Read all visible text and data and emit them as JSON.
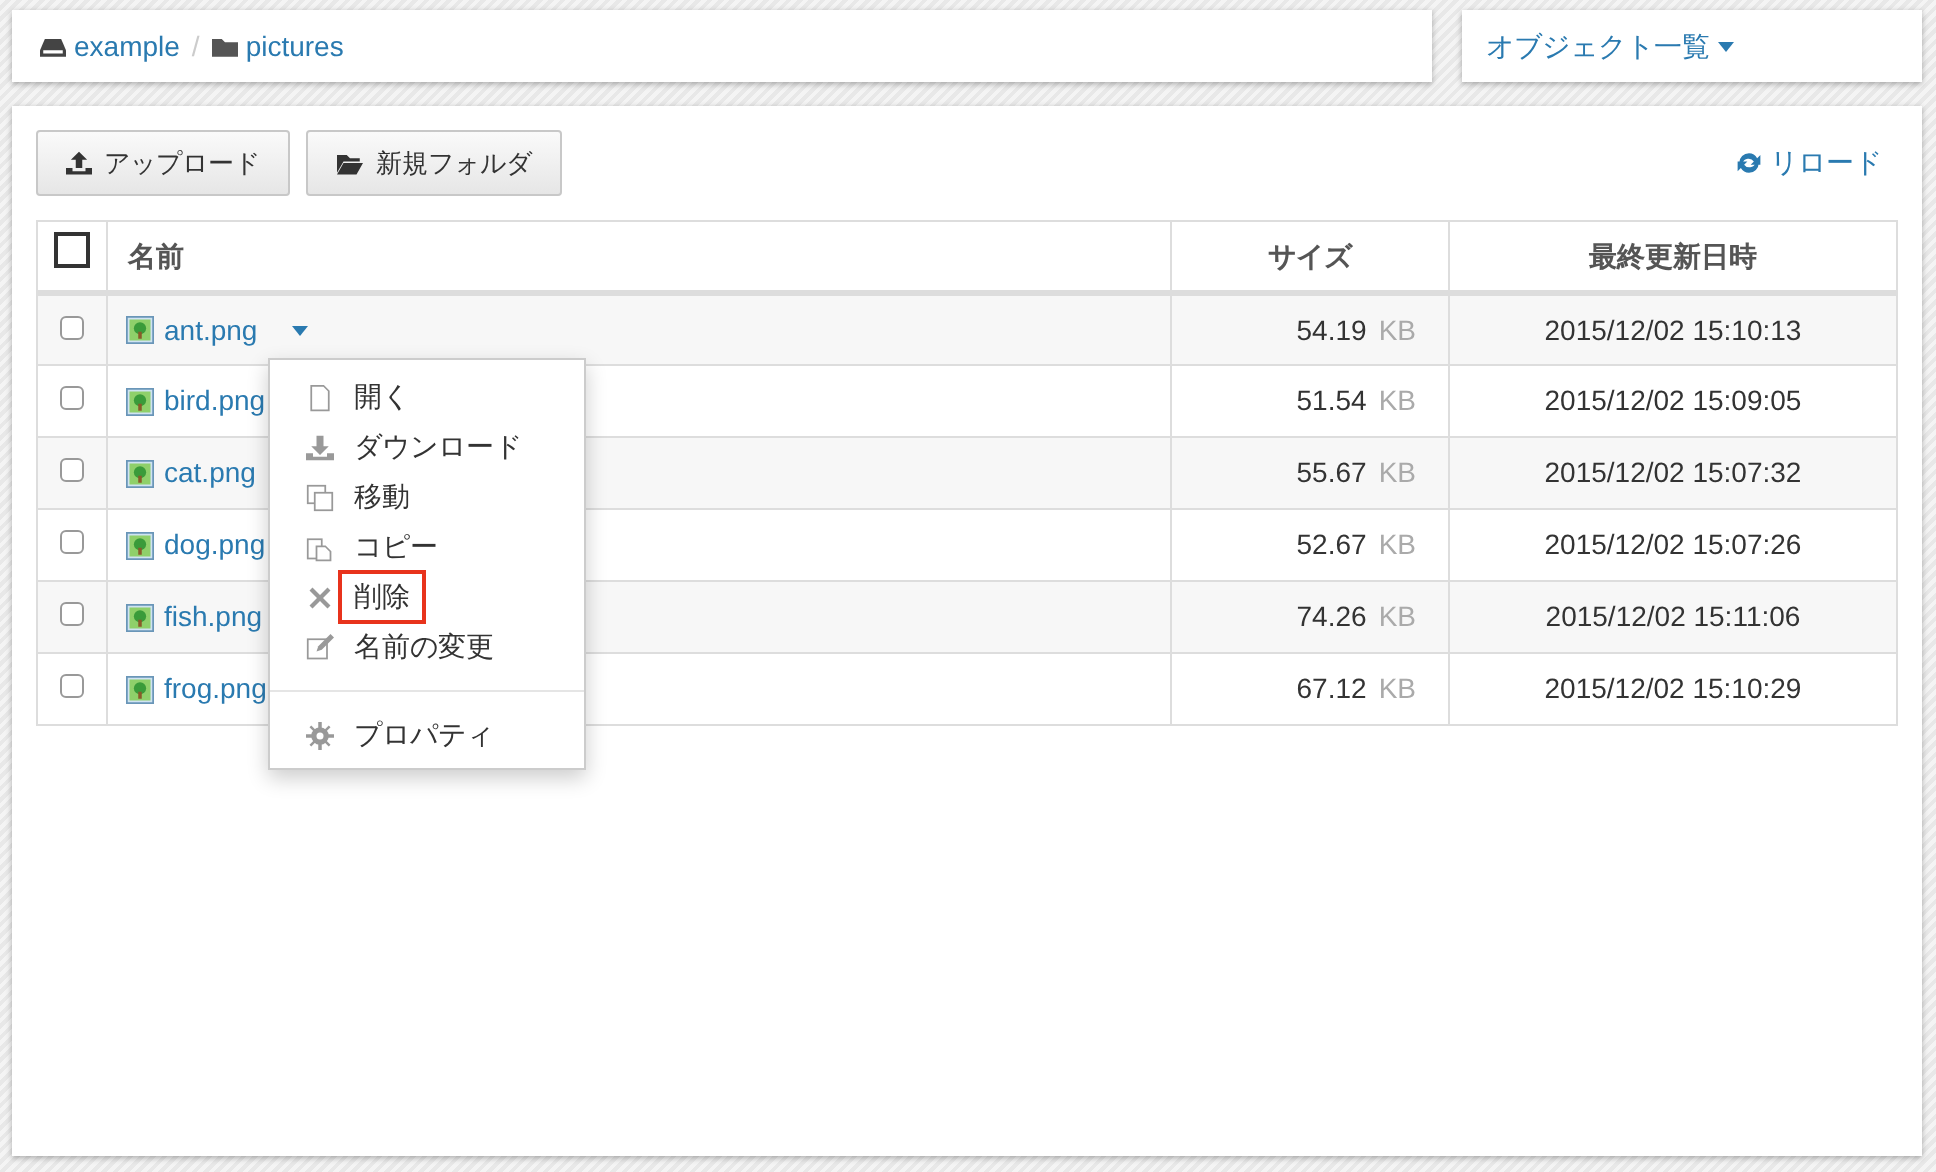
{
  "breadcrumb": [
    {
      "label": "example",
      "kind": "drive"
    },
    {
      "label": "pictures",
      "kind": "folder"
    }
  ],
  "breadcrumb_separator": "/",
  "view_menu": {
    "label": "オブジェクト一覧"
  },
  "toolbar": {
    "buttons": [
      {
        "label": "アップロード",
        "kind": "upload"
      },
      {
        "label": "新規フォルダ",
        "kind": "folder"
      }
    ],
    "reload": "リロード"
  },
  "table": {
    "select_all": {
      "checked": false
    },
    "columns": [
      "名前",
      "サイズ",
      "最終更新日時"
    ],
    "rows": [
      {
        "name": "ant.png",
        "size": "54.19",
        "unit": "KB",
        "modified": "2015/12/02 15:10:13",
        "checked": false,
        "menu_open": true
      },
      {
        "name": "bird.png",
        "size": "51.54",
        "unit": "KB",
        "modified": "2015/12/02 15:09:05",
        "checked": false,
        "menu_open": false
      },
      {
        "name": "cat.png",
        "size": "55.67",
        "unit": "KB",
        "modified": "2015/12/02 15:07:32",
        "checked": false,
        "menu_open": false
      },
      {
        "name": "dog.png",
        "size": "52.67",
        "unit": "KB",
        "modified": "2015/12/02 15:07:26",
        "checked": false,
        "menu_open": false
      },
      {
        "name": "fish.png",
        "size": "74.26",
        "unit": "KB",
        "modified": "2015/12/02 15:11:06",
        "checked": false,
        "menu_open": false
      },
      {
        "name": "frog.png",
        "size": "67.12",
        "unit": "KB",
        "modified": "2015/12/02 15:10:29",
        "checked": false,
        "menu_open": false
      }
    ]
  },
  "context_menu": {
    "items": [
      {
        "label": "開く",
        "kind": "open",
        "highlighted": false
      },
      {
        "label": "ダウンロード",
        "kind": "download",
        "highlighted": false
      },
      {
        "label": "移動",
        "kind": "move",
        "highlighted": false
      },
      {
        "label": "コピー",
        "kind": "copy",
        "highlighted": false
      },
      {
        "label": "削除",
        "kind": "delete",
        "highlighted": true
      },
      {
        "label": "名前の変更",
        "kind": "rename",
        "highlighted": false
      },
      {
        "kind": "divider"
      },
      {
        "label": "プロパティ",
        "kind": "properties",
        "highlighted": false
      }
    ]
  }
}
